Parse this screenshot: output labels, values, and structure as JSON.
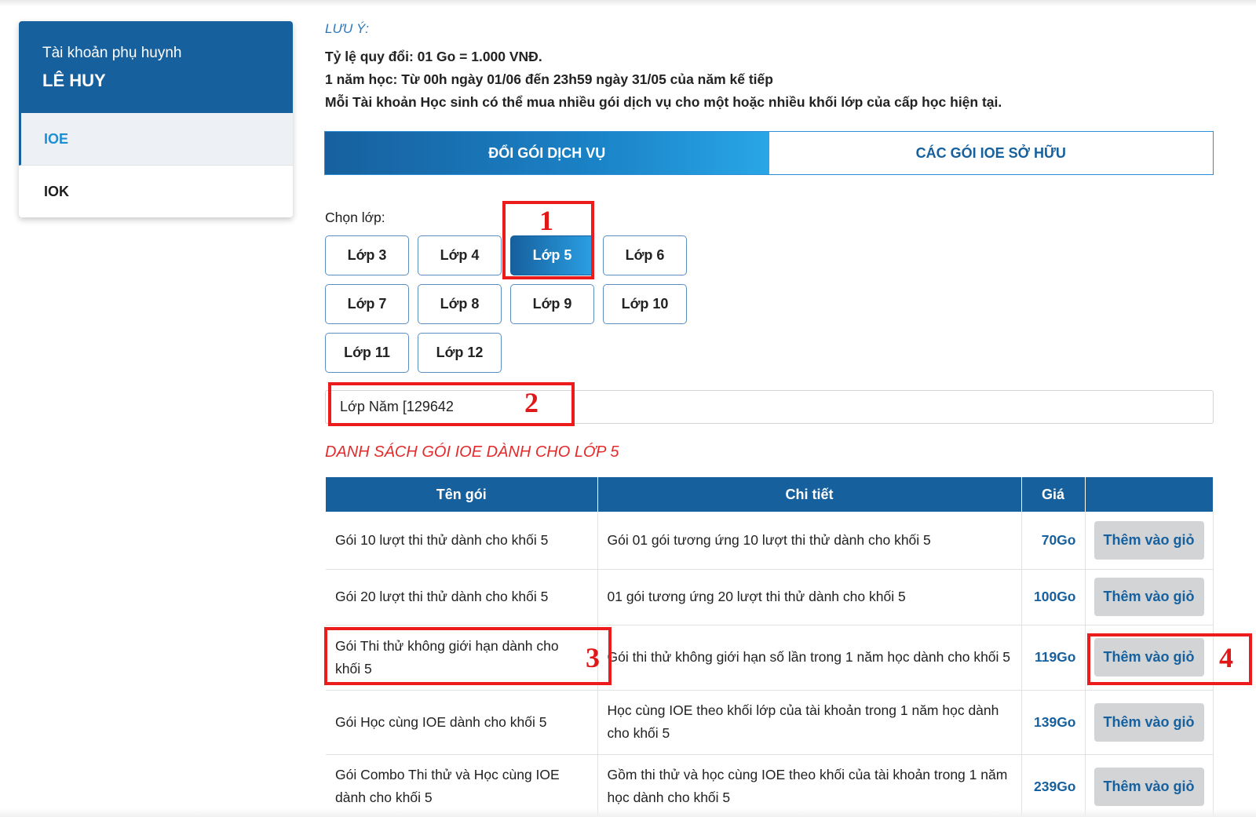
{
  "sidebar": {
    "account_label": "Tài khoản phụ huynh",
    "account_name": "LÊ HUY",
    "items": [
      {
        "label": "IOE",
        "active": true
      },
      {
        "label": "IOK",
        "active": false
      }
    ]
  },
  "notes": {
    "title": "LƯU Ý:",
    "lines": [
      "Tỷ lệ quy đổi: 01 Go = 1.000 VNĐ.",
      "1 năm học: Từ 00h ngày 01/06 đến 23h59 ngày 31/05 của năm kế tiếp",
      "Mỗi Tài khoản Học sinh có thể mua nhiều gói dịch vụ cho một hoặc nhiều khối lớp của cấp học hiện tại."
    ]
  },
  "tabs": [
    {
      "label": "ĐỔI GÓI DỊCH VỤ",
      "active": true
    },
    {
      "label": "CÁC GÓI IOE SỞ HỮU",
      "active": false
    }
  ],
  "grade_picker": {
    "label": "Chọn lớp:",
    "grades": [
      "Lớp 3",
      "Lớp 4",
      "Lớp 5",
      "Lớp 6",
      "Lớp 7",
      "Lớp 8",
      "Lớp 9",
      "Lớp 10",
      "Lớp 11",
      "Lớp 12"
    ],
    "selected": "Lớp 5"
  },
  "student_select": {
    "value": "Lớp Năm [129642"
  },
  "package_list": {
    "title": "DANH SÁCH GÓI IOE DÀNH CHO LỚP 5",
    "headers": [
      "Tên gói",
      "Chi tiết",
      "Giá",
      ""
    ],
    "rows": [
      {
        "name": "Gói 10 lượt thi thử dành cho khối 5",
        "detail": "Gói 01 gói tương ứng 10 lượt thi thử dành cho khối 5",
        "price": "70Go",
        "action": "Thêm vào giỏ"
      },
      {
        "name": "Gói 20 lượt thi thử dành cho khối 5",
        "detail": "01 gói tương ứng 20 lượt thi thử dành cho khối 5",
        "price": "100Go",
        "action": "Thêm vào giỏ"
      },
      {
        "name": "Gói Thi thử không giới hạn dành cho khối 5",
        "detail": "Gói thi thử không giới hạn số lần trong 1 năm học dành cho khối 5",
        "price": "119Go",
        "action": "Thêm vào giỏ"
      },
      {
        "name": "Gói Học cùng IOE dành cho khối 5",
        "detail": "Học cùng IOE theo khối lớp của tài khoản trong 1 năm học dành cho khối 5",
        "price": "139Go",
        "action": "Thêm vào giỏ"
      },
      {
        "name": "Gói Combo Thi thử và Học cùng IOE dành cho khối 5",
        "detail": "Gồm thi thử và học cùng IOE theo khối của tài khoản trong 1 năm học dành cho khối 5",
        "price": "239Go",
        "action": "Thêm vào giỏ"
      }
    ]
  },
  "annotations": [
    "1",
    "2",
    "3",
    "4"
  ],
  "colors": {
    "brand_blue": "#17609e",
    "light_blue": "#2aa0e3",
    "annotation_red": "#ec1c1c",
    "list_title_red": "#e32b2b",
    "button_gray": "#d2d4d6"
  }
}
